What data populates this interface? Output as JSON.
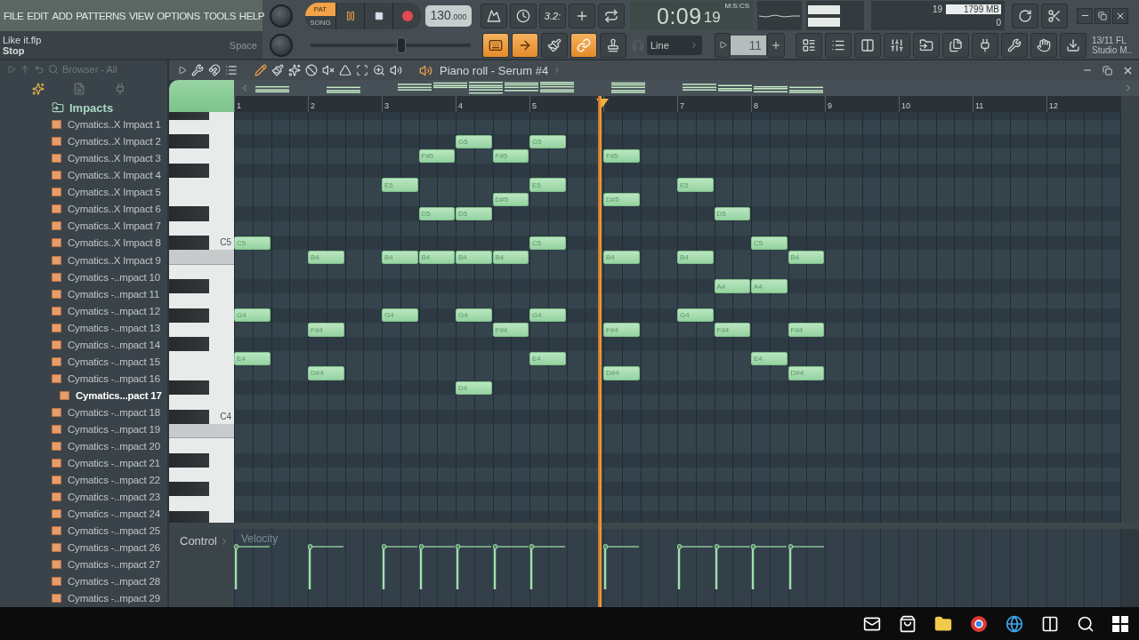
{
  "menu": [
    "FILE",
    "EDIT",
    "ADD",
    "PATTERNS",
    "VIEW",
    "OPTIONS",
    "TOOLS",
    "HELP"
  ],
  "transport": {
    "modes": [
      {
        "label": "PAT",
        "selected": true
      },
      {
        "label": "SONG",
        "selected": false
      }
    ],
    "tempo": "130",
    "tempo_fraction": ".000",
    "countdown": "3.2:",
    "time": "0:09",
    "time_fraction": "19",
    "time_format": "M:S:CS",
    "cpu": "19",
    "memory": "1799 MB",
    "polyphony": "0"
  },
  "pitch": {
    "level": 0.57
  },
  "hint": {
    "file": "Like it.flp",
    "action": "Stop",
    "shortcut": "Space"
  },
  "toolbar": {
    "snap": "Line",
    "step": "11",
    "news": [
      "13/11  FL",
      "Studio M.."
    ]
  },
  "browser": {
    "title": "Browser - All",
    "folder": "Impacts",
    "items": [
      {
        "label": "Cymatics..X Impact 1",
        "selected": false
      },
      {
        "label": "Cymatics..X Impact 2",
        "selected": false
      },
      {
        "label": "Cymatics..X Impact 3",
        "selected": false
      },
      {
        "label": "Cymatics..X Impact 4",
        "selected": false
      },
      {
        "label": "Cymatics..X Impact 5",
        "selected": false
      },
      {
        "label": "Cymatics..X Impact 6",
        "selected": false
      },
      {
        "label": "Cymatics..X Impact 7",
        "selected": false
      },
      {
        "label": "Cymatics..X Impact 8",
        "selected": false
      },
      {
        "label": "Cymatics..X Impact 9",
        "selected": false
      },
      {
        "label": "Cymatics -..mpact 10",
        "selected": false
      },
      {
        "label": "Cymatics -..mpact 11",
        "selected": false
      },
      {
        "label": "Cymatics -..mpact 12",
        "selected": false
      },
      {
        "label": "Cymatics -..mpact 13",
        "selected": false
      },
      {
        "label": "Cymatics -..mpact 14",
        "selected": false
      },
      {
        "label": "Cymatics -..mpact 15",
        "selected": false
      },
      {
        "label": "Cymatics -..mpact 16",
        "selected": false
      },
      {
        "label": "Cymatics...pact 17",
        "selected": true
      },
      {
        "label": "Cymatics -..mpact 18",
        "selected": false
      },
      {
        "label": "Cymatics -..mpact 19",
        "selected": false
      },
      {
        "label": "Cymatics -..mpact 20",
        "selected": false
      },
      {
        "label": "Cymatics -..mpact 21",
        "selected": false
      },
      {
        "label": "Cymatics -..mpact 22",
        "selected": false
      },
      {
        "label": "Cymatics -..mpact 23",
        "selected": false
      },
      {
        "label": "Cymatics -..mpact 24",
        "selected": false
      },
      {
        "label": "Cymatics -..mpact 25",
        "selected": false
      },
      {
        "label": "Cymatics -..mpact 26",
        "selected": false
      },
      {
        "label": "Cymatics -..mpact 27",
        "selected": false
      },
      {
        "label": "Cymatics -..mpact 28",
        "selected": false
      },
      {
        "label": "Cymatics -..mpact 29",
        "selected": false
      }
    ]
  },
  "piano_roll": {
    "title": "Piano roll - Serum #4",
    "bars": [
      {
        "kind": "number",
        "label": "1"
      },
      {
        "kind": "number",
        "label": "2"
      },
      {
        "kind": "number",
        "label": "3"
      },
      {
        "kind": "number",
        "label": "4"
      },
      {
        "kind": "number",
        "label": "5"
      },
      {
        "kind": "marker"
      },
      {
        "kind": "number",
        "label": "7"
      },
      {
        "kind": "number",
        "label": "8"
      },
      {
        "kind": "number",
        "label": "9"
      },
      {
        "kind": "number",
        "label": "10"
      },
      {
        "kind": "number",
        "label": "11"
      },
      {
        "kind": "number",
        "label": "12"
      }
    ],
    "keyboard_labels": [
      "C5",
      "C4"
    ],
    "rows": [
      {
        "kind": "notes",
        "cells": [
          {
            "kind": "gap"
          },
          {
            "kind": "gap"
          },
          {
            "kind": "gap"
          },
          {
            "kind": "gap"
          },
          {
            "kind": "gap"
          },
          {
            "kind": "gap"
          },
          {
            "kind": "note",
            "label": "G5"
          },
          {
            "kind": "gap"
          },
          {
            "kind": "note",
            "label": "G5"
          }
        ]
      },
      {
        "kind": "notes",
        "cells": [
          {
            "kind": "gap"
          },
          {
            "kind": "gap"
          },
          {
            "kind": "gap"
          },
          {
            "kind": "gap"
          },
          {
            "kind": "gap"
          },
          {
            "kind": "note",
            "label": "F#5"
          },
          {
            "kind": "gap"
          },
          {
            "kind": "note",
            "label": "F#5"
          },
          {
            "kind": "gap"
          },
          {
            "kind": "gap"
          },
          {
            "kind": "note",
            "label": "F#5"
          }
        ]
      },
      {
        "kind": "blank"
      },
      {
        "kind": "notes",
        "cells": [
          {
            "kind": "gap"
          },
          {
            "kind": "gap"
          },
          {
            "kind": "gap"
          },
          {
            "kind": "gap"
          },
          {
            "kind": "note",
            "label": "E5"
          },
          {
            "kind": "gap"
          },
          {
            "kind": "gap"
          },
          {
            "kind": "gap"
          },
          {
            "kind": "note",
            "label": "E5"
          },
          {
            "kind": "gap"
          },
          {
            "kind": "gap"
          },
          {
            "kind": "gap"
          },
          {
            "kind": "note",
            "label": "E5"
          }
        ]
      },
      {
        "kind": "notes",
        "cells": [
          {
            "kind": "gap"
          },
          {
            "kind": "gap"
          },
          {
            "kind": "gap"
          },
          {
            "kind": "gap"
          },
          {
            "kind": "gap"
          },
          {
            "kind": "gap"
          },
          {
            "kind": "gap"
          },
          {
            "kind": "note",
            "label": "D#5"
          },
          {
            "kind": "gap"
          },
          {
            "kind": "gap"
          },
          {
            "kind": "note",
            "label": "D#5"
          }
        ]
      },
      {
        "kind": "notes",
        "cells": [
          {
            "kind": "gap"
          },
          {
            "kind": "gap"
          },
          {
            "kind": "gap"
          },
          {
            "kind": "gap"
          },
          {
            "kind": "gap"
          },
          {
            "kind": "note",
            "label": "D5"
          },
          {
            "kind": "note",
            "label": "D5"
          },
          {
            "kind": "gap"
          },
          {
            "kind": "gap"
          },
          {
            "kind": "gap"
          },
          {
            "kind": "gap"
          },
          {
            "kind": "gap"
          },
          {
            "kind": "gap"
          },
          {
            "kind": "note",
            "label": "D5"
          }
        ]
      },
      {
        "kind": "blank"
      },
      {
        "kind": "notes",
        "cells": [
          {
            "kind": "note",
            "label": "C5"
          },
          {
            "kind": "gap"
          },
          {
            "kind": "gap"
          },
          {
            "kind": "gap"
          },
          {
            "kind": "gap"
          },
          {
            "kind": "gap"
          },
          {
            "kind": "gap"
          },
          {
            "kind": "gap"
          },
          {
            "kind": "note",
            "label": "C5"
          },
          {
            "kind": "gap"
          },
          {
            "kind": "gap"
          },
          {
            "kind": "gap"
          },
          {
            "kind": "gap"
          },
          {
            "kind": "gap"
          },
          {
            "kind": "note",
            "label": "C5"
          }
        ]
      },
      {
        "kind": "notes",
        "cells": [
          {
            "kind": "gap"
          },
          {
            "kind": "gap"
          },
          {
            "kind": "note",
            "label": "B4"
          },
          {
            "kind": "gap"
          },
          {
            "kind": "note",
            "label": "B4"
          },
          {
            "kind": "note",
            "label": "B4"
          },
          {
            "kind": "note",
            "label": "B4"
          },
          {
            "kind": "note",
            "label": "B4"
          },
          {
            "kind": "gap"
          },
          {
            "kind": "gap"
          },
          {
            "kind": "note",
            "label": "B4"
          },
          {
            "kind": "gap"
          },
          {
            "kind": "note",
            "label": "B4"
          },
          {
            "kind": "gap"
          },
          {
            "kind": "gap"
          },
          {
            "kind": "note",
            "label": "B4"
          }
        ]
      },
      {
        "kind": "blank"
      },
      {
        "kind": "notes",
        "cells": [
          {
            "kind": "gap"
          },
          {
            "kind": "gap"
          },
          {
            "kind": "gap"
          },
          {
            "kind": "gap"
          },
          {
            "kind": "gap"
          },
          {
            "kind": "gap"
          },
          {
            "kind": "gap"
          },
          {
            "kind": "gap"
          },
          {
            "kind": "gap"
          },
          {
            "kind": "gap"
          },
          {
            "kind": "gap"
          },
          {
            "kind": "gap"
          },
          {
            "kind": "gap"
          },
          {
            "kind": "note",
            "label": "A4"
          },
          {
            "kind": "note",
            "label": "A4"
          }
        ]
      },
      {
        "kind": "blank"
      },
      {
        "kind": "notes",
        "cells": [
          {
            "kind": "note",
            "label": "G4"
          },
          {
            "kind": "gap"
          },
          {
            "kind": "gap"
          },
          {
            "kind": "gap"
          },
          {
            "kind": "note",
            "label": "G4"
          },
          {
            "kind": "gap"
          },
          {
            "kind": "note",
            "label": "G4"
          },
          {
            "kind": "gap"
          },
          {
            "kind": "note",
            "label": "G4"
          },
          {
            "kind": "gap"
          },
          {
            "kind": "gap"
          },
          {
            "kind": "gap"
          },
          {
            "kind": "note",
            "label": "G4"
          }
        ]
      },
      {
        "kind": "notes",
        "cells": [
          {
            "kind": "gap"
          },
          {
            "kind": "gap"
          },
          {
            "kind": "note",
            "label": "F#4"
          },
          {
            "kind": "gap"
          },
          {
            "kind": "gap"
          },
          {
            "kind": "gap"
          },
          {
            "kind": "gap"
          },
          {
            "kind": "note",
            "label": "F#4"
          },
          {
            "kind": "gap"
          },
          {
            "kind": "gap"
          },
          {
            "kind": "note",
            "label": "F#4"
          },
          {
            "kind": "gap"
          },
          {
            "kind": "gap"
          },
          {
            "kind": "note",
            "label": "F#4"
          },
          {
            "kind": "gap"
          },
          {
            "kind": "note",
            "label": "F#4"
          }
        ]
      },
      {
        "kind": "blank"
      },
      {
        "kind": "notes",
        "cells": [
          {
            "kind": "note",
            "label": "E4"
          },
          {
            "kind": "gap"
          },
          {
            "kind": "gap"
          },
          {
            "kind": "gap"
          },
          {
            "kind": "gap"
          },
          {
            "kind": "gap"
          },
          {
            "kind": "gap"
          },
          {
            "kind": "gap"
          },
          {
            "kind": "note",
            "label": "E4"
          },
          {
            "kind": "gap"
          },
          {
            "kind": "gap"
          },
          {
            "kind": "gap"
          },
          {
            "kind": "gap"
          },
          {
            "kind": "gap"
          },
          {
            "kind": "note",
            "label": "E4"
          }
        ]
      },
      {
        "kind": "notes",
        "cells": [
          {
            "kind": "gap"
          },
          {
            "kind": "gap"
          },
          {
            "kind": "note",
            "label": "D#4"
          },
          {
            "kind": "gap"
          },
          {
            "kind": "gap"
          },
          {
            "kind": "gap"
          },
          {
            "kind": "gap"
          },
          {
            "kind": "gap"
          },
          {
            "kind": "gap"
          },
          {
            "kind": "gap"
          },
          {
            "kind": "note",
            "label": "D#4"
          },
          {
            "kind": "gap"
          },
          {
            "kind": "gap"
          },
          {
            "kind": "gap"
          },
          {
            "kind": "gap"
          },
          {
            "kind": "note",
            "label": "D#4"
          }
        ]
      },
      {
        "kind": "notes",
        "cells": [
          {
            "kind": "gap"
          },
          {
            "kind": "gap"
          },
          {
            "kind": "gap"
          },
          {
            "kind": "gap"
          },
          {
            "kind": "gap"
          },
          {
            "kind": "gap"
          },
          {
            "kind": "note",
            "label": "D4"
          }
        ]
      }
    ],
    "control": {
      "label": "Control",
      "lane": "Velocity"
    }
  }
}
